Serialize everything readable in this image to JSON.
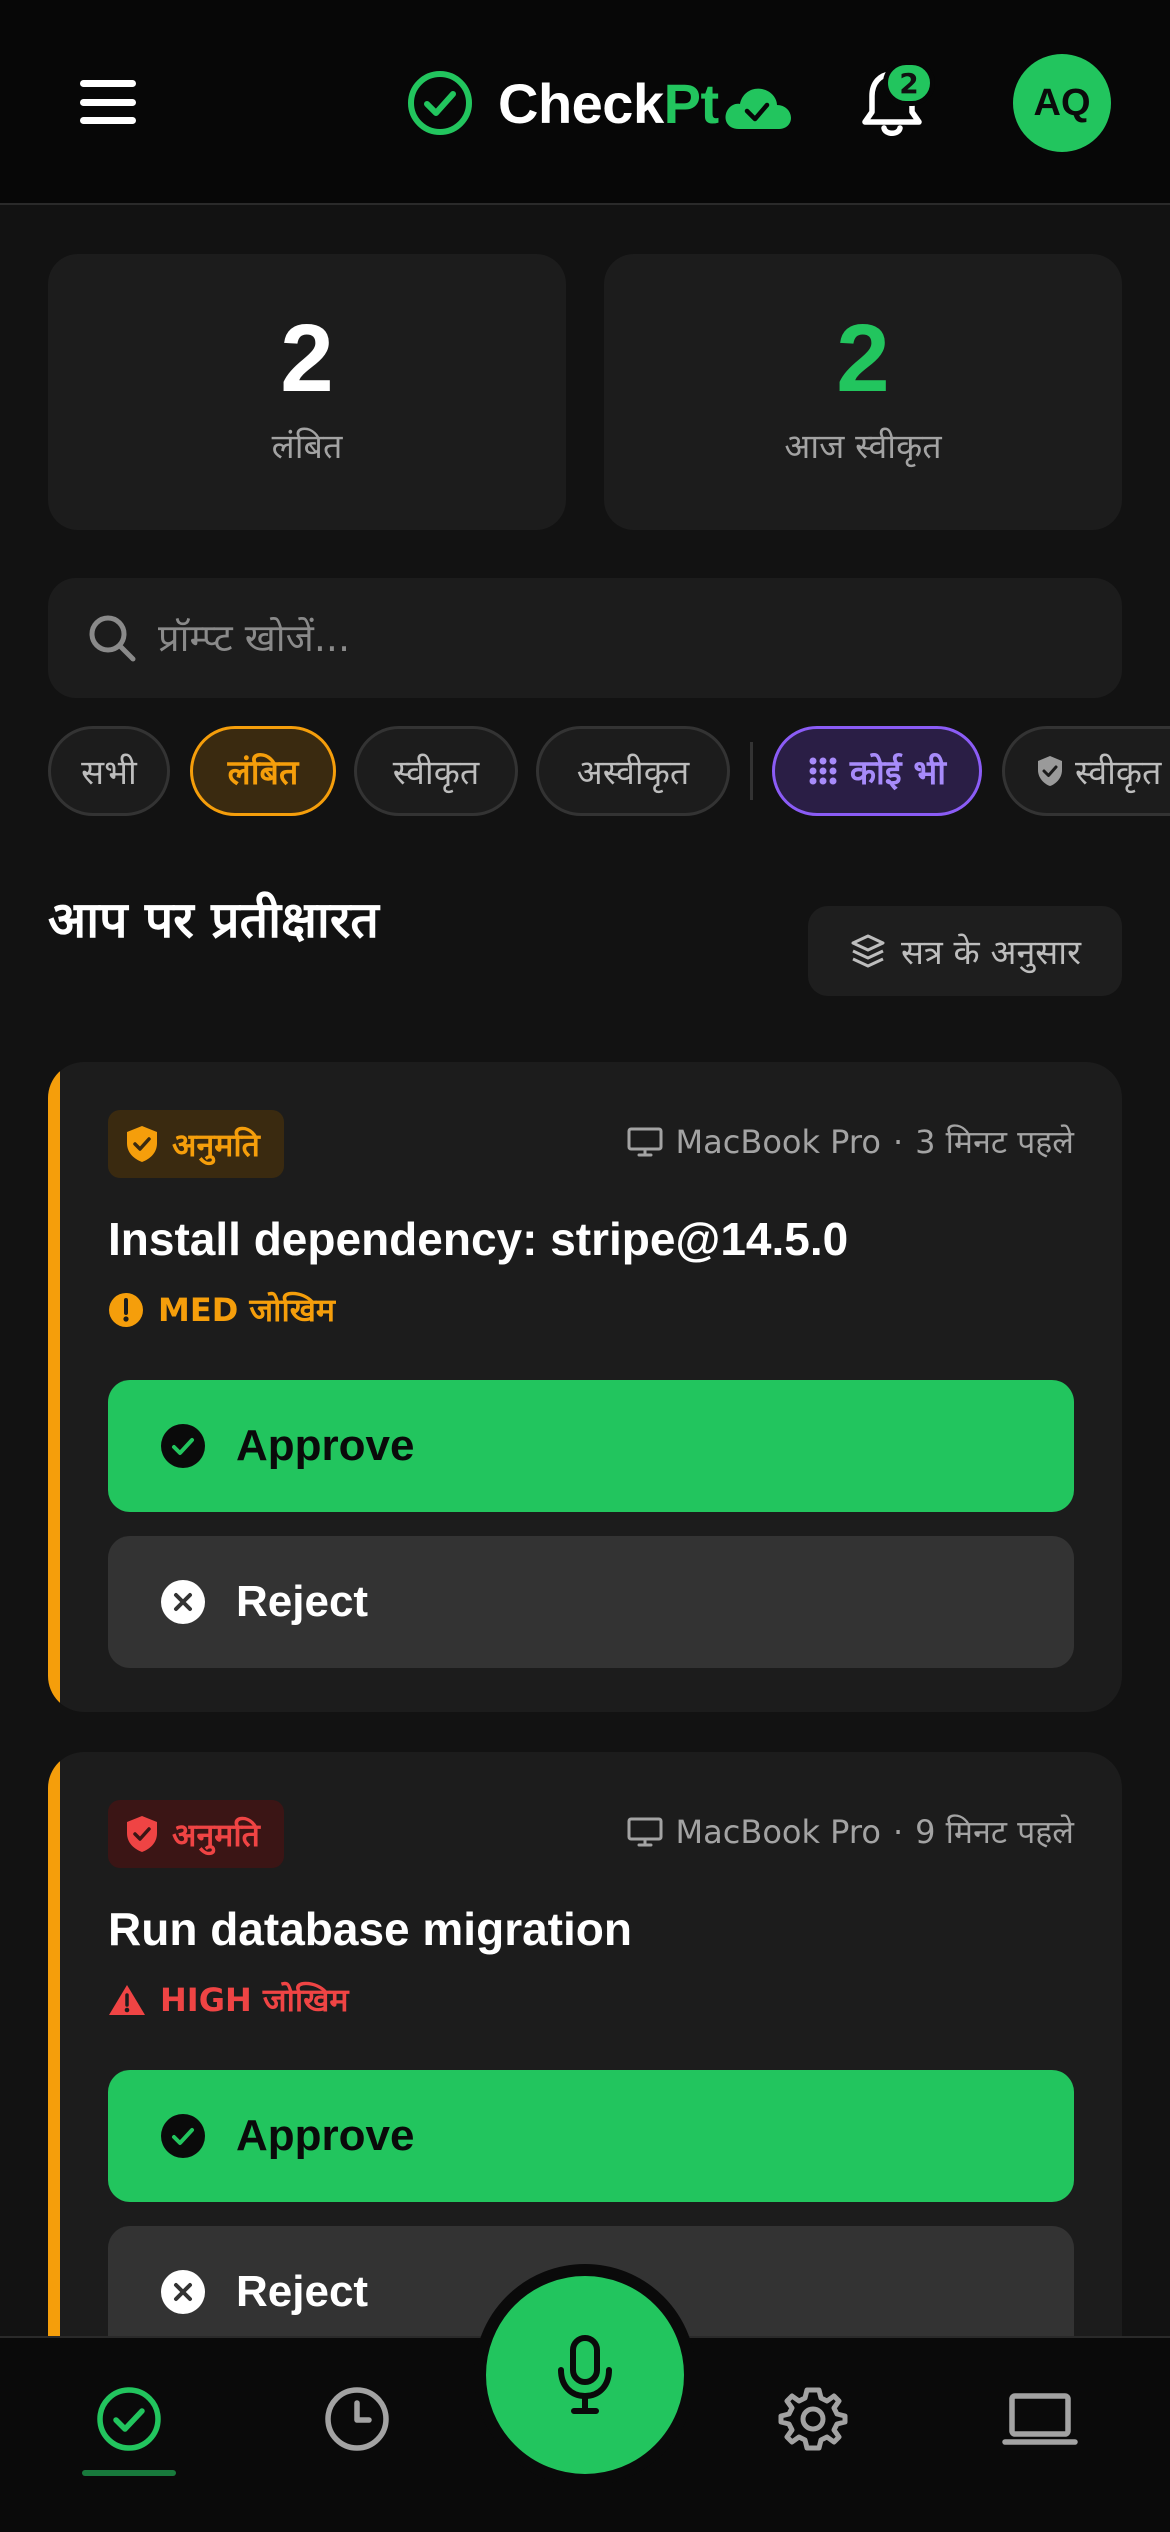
{
  "header": {
    "brand_white": "Check",
    "brand_green": "Pt",
    "notification_count": "2",
    "avatar_initials": "AQ"
  },
  "stats": [
    {
      "value": "2",
      "label": "लंबित",
      "color": "#ffffff"
    },
    {
      "value": "2",
      "label": "आज स्वीकृत",
      "color": "#22c55e"
    }
  ],
  "search": {
    "placeholder": "प्रॉम्प्ट खोजें..."
  },
  "filters": {
    "status": [
      "सभी",
      "लंबित",
      "स्वीकृत",
      "अस्वीकृत"
    ],
    "type_any": "कोई भी",
    "type_approved": "स्वीकृत"
  },
  "section": {
    "title": "आप पर प्रतीक्षारत",
    "group_by": "सत्र के अनुसार"
  },
  "cards": [
    {
      "tag": "अनुमति",
      "device": "MacBook Pro",
      "time": "3 मिनट पहले",
      "title": "Install dependency: stripe@14.5.0",
      "risk": "MED जोखिम",
      "risk_color": "#f59e0b",
      "approve": "Approve",
      "reject": "Reject"
    },
    {
      "tag": "अनुमति",
      "device": "MacBook Pro",
      "time": "9 मिनट पहले",
      "title": "Run database migration",
      "risk": "HIGH जोखिम",
      "risk_color": "#ef4444",
      "approve": "Approve",
      "reject": "Reject"
    }
  ],
  "icons": {
    "nav": [
      "check-circle-icon",
      "clock-icon",
      "microphone-icon",
      "gear-icon",
      "laptop-icon"
    ]
  },
  "colors": {
    "accent": "#22c55e",
    "warning": "#f59e0b",
    "danger": "#ef4444",
    "purple": "#8b5cf6"
  }
}
